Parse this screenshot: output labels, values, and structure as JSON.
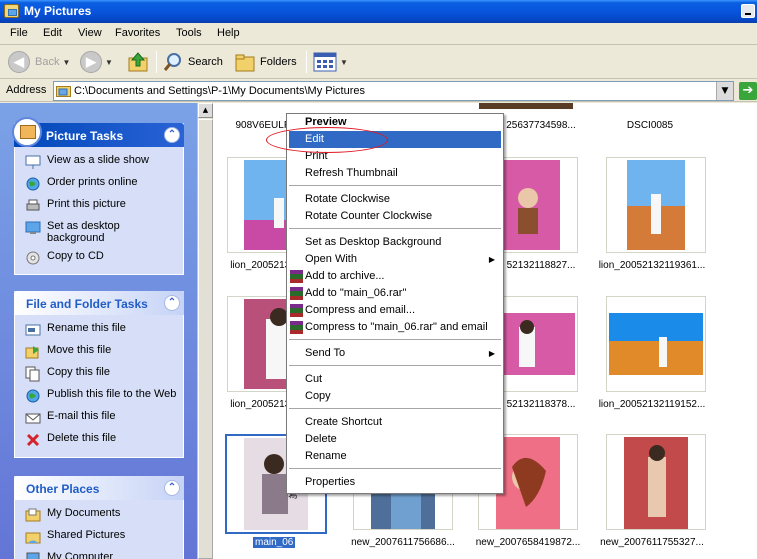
{
  "window": {
    "title": "My Pictures"
  },
  "menubar": [
    "File",
    "Edit",
    "View",
    "Favorites",
    "Tools",
    "Help"
  ],
  "toolbar": {
    "back": "Back",
    "search": "Search",
    "folders": "Folders"
  },
  "address": {
    "label": "Address",
    "path": "C:\\Documents and Settings\\P-1\\My Documents\\My Pictures"
  },
  "picture_tasks": {
    "title": "Picture Tasks",
    "items": [
      "View as a slide show",
      "Order prints online",
      "Print this picture",
      "Set as desktop background",
      "Copy to CD"
    ]
  },
  "file_tasks": {
    "title": "File and Folder Tasks",
    "items": [
      "Rename this file",
      "Move this file",
      "Copy this file",
      "Publish this file to the Web",
      "E-mail this file",
      "Delete this file"
    ]
  },
  "other_places": {
    "title": "Other Places",
    "items": [
      "My Documents",
      "Shared Pictures",
      "My Computer"
    ]
  },
  "files": {
    "row1": [
      "908V6EULP",
      "25637734598...",
      "DSCI0085"
    ],
    "row2": [
      "lion_20052132",
      "52132118827...",
      "lion_20052132119361..."
    ],
    "row3": [
      "lion_20052132",
      "52132118378...",
      "lion_20052132119152..."
    ],
    "row4": [
      "main_06",
      "new_2007611756686...",
      "new_2007658419872...",
      "new_2007611755327..."
    ]
  },
  "context_menu": {
    "items": [
      "Preview",
      "Edit",
      "Print",
      "Refresh Thumbnail",
      "Rotate Clockwise",
      "Rotate Counter Clockwise",
      "Set as Desktop Background",
      "Open With",
      "Add to archive...",
      "Add to \"main_06.rar\"",
      "Compress and email...",
      "Compress to \"main_06.rar\" and email",
      "Send To",
      "Cut",
      "Copy",
      "Create Shortcut",
      "Delete",
      "Rename",
      "Properties"
    ]
  }
}
